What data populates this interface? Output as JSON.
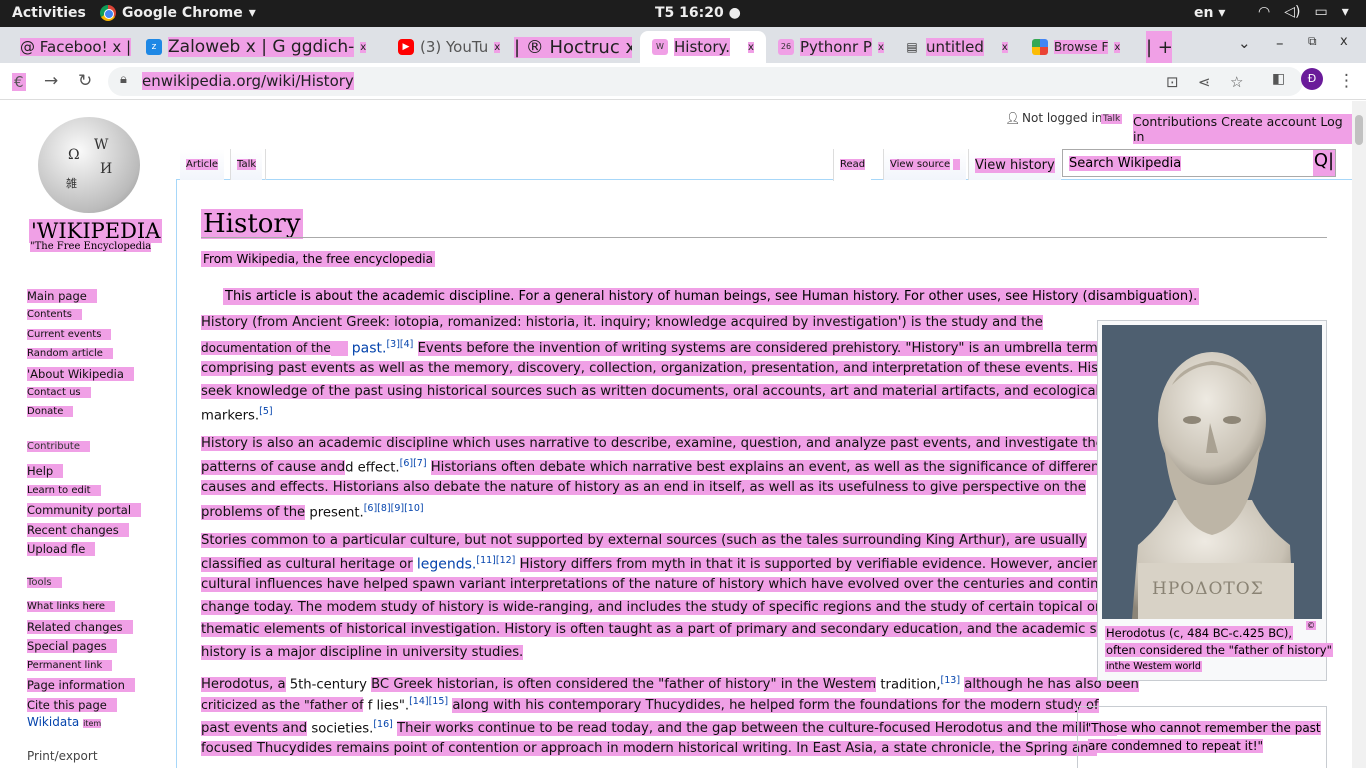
{
  "system_bar": {
    "activities": "Activities",
    "app_name": "Google Chrome",
    "clock": "T5 16:20",
    "language": "en"
  },
  "tabs": [
    {
      "title": "@ Faceboo! x |"
    },
    {
      "title": "Zaloweb x | G ggdich-"
    },
    {
      "title": "(3) YouTu"
    },
    {
      "title": "| ® Hoctruc x"
    },
    {
      "title": "History.",
      "active": true
    },
    {
      "title": "Pythonr P"
    },
    {
      "title": "untitled"
    },
    {
      "title": "Browse F"
    }
  ],
  "toolbar": {
    "left_badge": "€",
    "url": "enwikipedia.org/wiki/History",
    "profile_initial": "Đ"
  },
  "wiki": {
    "wordmark": "'WIKIPEDIA",
    "tagline": "\"The Free Encyclopedia",
    "nav": [
      "Main page",
      "Contents",
      "Current events",
      "Random article",
      "'About Wikipedia",
      "Contact us",
      "Donate"
    ],
    "contribute_heading": "Contribute",
    "contribute": [
      "Help",
      "Learn to edit",
      "Community portal",
      "Recent changes",
      "Upload fle"
    ],
    "tools_heading": "Tools",
    "tools": [
      "What links here",
      "Related changes",
      "Special pages",
      "Permanent link",
      "Page information",
      "Cite this page"
    ],
    "wikidata": "Wikidata",
    "wikidata_item": "item",
    "print_heading": "Print/export",
    "user": {
      "not_logged": "Not logged in",
      "talk": "Talk",
      "links": "Contributions Create account Log in"
    },
    "tabs": {
      "article": "Article",
      "talk": "Talk",
      "read": "Read",
      "view_source": "View source",
      "view_history": "View history"
    },
    "search_placeholder": "Search Wikipedia",
    "search_icon": "Q|",
    "title": "History",
    "from": "From Wikipedia, the free encyclopedia",
    "hatnote": "This article is about the academic discipline. For a general history of human beings, see Human history. For other uses, see History (disambiguation).",
    "para1": {
      "l1": "History (from Ancient Greek: iotopia, romanized: historia, it. inquiry; knowledge acquired by investigation') is the study and the",
      "l2a": "documentation of the",
      "l2b": "past.",
      "l2ref": "[3][4]",
      "l2c": "Events before the invention of writing systems are considered prehistory. \"History\" is an umbrella term",
      "l3": "comprising past events as well as the memory, discovery, collection, organization, presentation, and interpretation of these events. Historians",
      "l4": "seek knowledge of the past using historical sources such as written documents, oral accounts, art and material artifacts, and ecological",
      "l5": "markers.",
      "l5ref": "[5]"
    },
    "para2": {
      "l1": "History is also an academic discipline which uses narrative to describe, examine, question, and analyze past events, and investigate their",
      "l2a": "patterns of cause and",
      "l2b": "d effect.",
      "l2ref": "[6][7]",
      "l2c": "Historians often debate which narrative best explains an event, as well as the significance of different",
      "l3": "causes and effects. Historians also debate the nature of history as an end in itself, as well as its usefulness to give perspective on the",
      "l4a": "problems of the",
      "l4b": "present.",
      "l4ref": "[6][8][9][10]"
    },
    "para3": {
      "l1": "Stories common to a particular culture, but not supported by external sources (such as the tales surrounding King Arthur), are usually",
      "l2a": "classified as cultural heritage or",
      "l2b": "legends.",
      "l2ref": "[11][12]",
      "l2c": "History differs from myth in that it is supported by verifiable evidence. However, ancient",
      "l3": "cultural influences have helped spawn variant interpretations of the nature of history which have evolved over the centuries and continue to",
      "l4": "change today. The modem study of history is wide-ranging, and includes the study of specific regions and the study of certain topical or",
      "l5": "thematic elements of historical investigation. History is often taught as a part of primary and secondary education, and the academic study of",
      "l6": "history is a major discipline in university studies."
    },
    "para4": {
      "l1a": "Herodotus, a",
      "l1b": "5th-century",
      "l1c": "BC Greek historian, is often considered the \"father of history\" in the Westem",
      "l1d": "tradition,",
      "l1ref": "[13]",
      "l1e": "although he has also been",
      "l2a": "criticized as the \"father of",
      "l2b": "f lies\".",
      "l2ref": "[14][15]",
      "l2c": "along with his contemporary Thucydides, he helped form the foundations for the modern study of",
      "l3a": "past events and",
      "l3b": "societies.",
      "l3ref": "[16]",
      "l3c": "Their works continue to be read today, and the gap between the culture-focused Herodotus and the military-",
      "l4": "focused Thucydides remains point of contention or approach in modern historical writing. In East Asia, a state chronicle, the Spring and"
    },
    "infobox": {
      "inscription": "ΗΡΟΔΟΤΟΣ",
      "cap1": "Herodotus (c, 484 BC-c.425 BC),",
      "cap2": "often considered the \"father of history\"",
      "cap3": "inthe Westem world",
      "cap_mark": "©"
    },
    "quote": {
      "l1": "'Those who cannot remember the past",
      "l2": "are condemned to repeat it!\""
    }
  }
}
